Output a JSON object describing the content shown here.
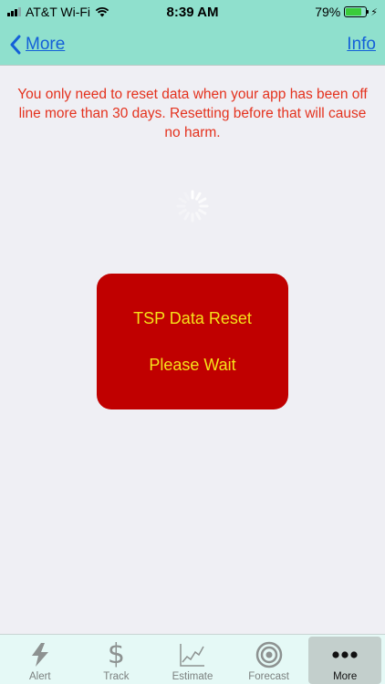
{
  "status_bar": {
    "carrier": "AT&T Wi-Fi",
    "time": "8:39 AM",
    "battery_percent": "79%",
    "battery_level": 0.79
  },
  "nav": {
    "back_label": "More",
    "right_label": "Info"
  },
  "notice": {
    "text": "You only need to reset data when your app has been off line more than 30 days. Resetting before that will cause no harm."
  },
  "reset_dialog": {
    "title": "TSP Data Reset",
    "message": "Please Wait"
  },
  "tabs": [
    {
      "label": "Alert",
      "icon": "lightning-icon",
      "active": false
    },
    {
      "label": "Track",
      "icon": "dollar-icon",
      "active": false
    },
    {
      "label": "Estimate",
      "icon": "chart-line-icon",
      "active": false
    },
    {
      "label": "Forecast",
      "icon": "target-icon",
      "active": false
    },
    {
      "label": "More",
      "icon": "more-dots-icon",
      "active": true
    }
  ],
  "colors": {
    "header": "#8fe0cd",
    "link": "#1460d8",
    "notice": "#e4321e",
    "dialog_bg": "#c00000",
    "dialog_text": "#f5e11a"
  }
}
